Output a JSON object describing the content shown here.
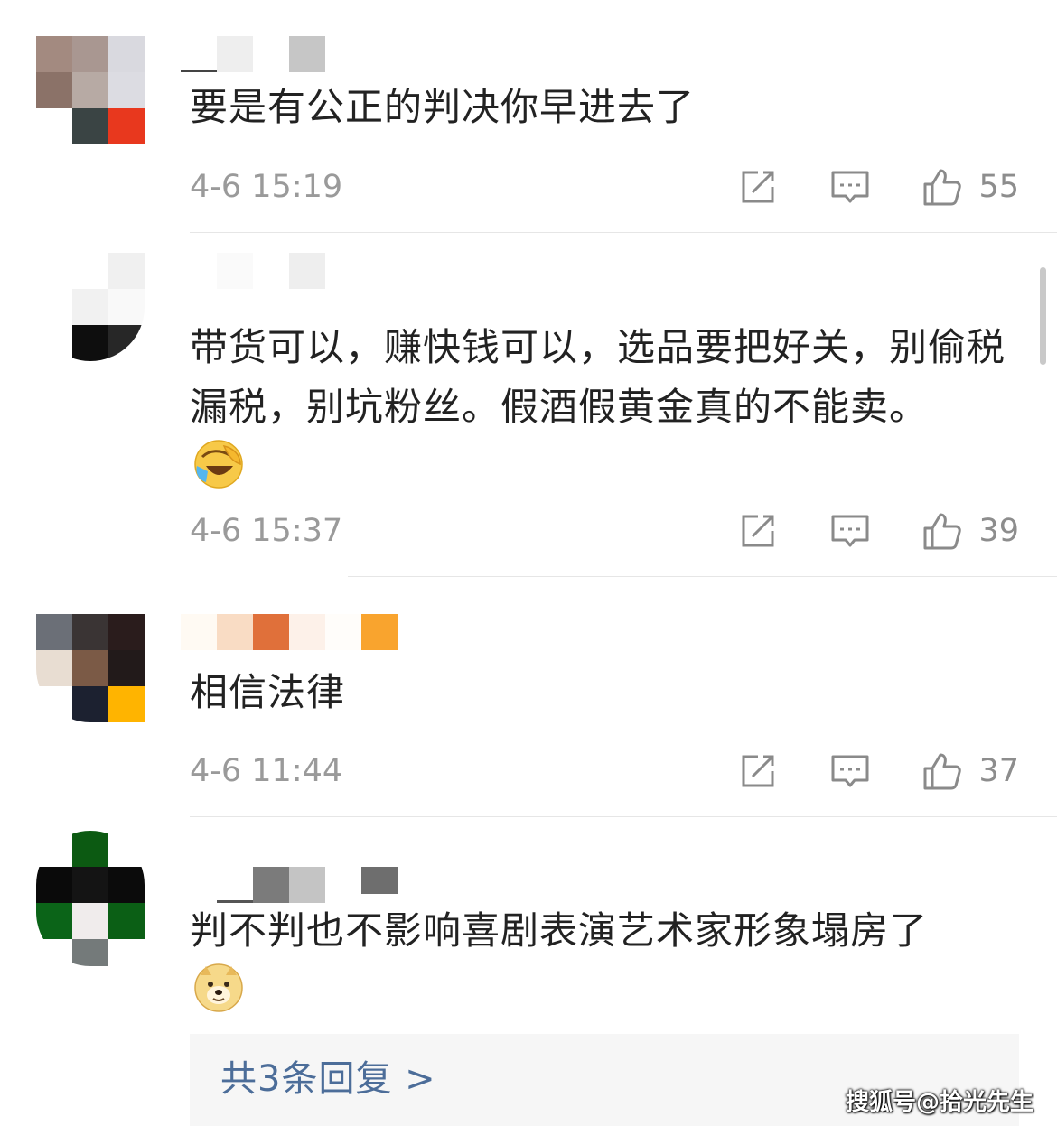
{
  "comments": [
    {
      "text": "要是有公正的判决你早进去了",
      "time": "4-6 15:19",
      "likes": "55"
    },
    {
      "text": "带货可以，赚快钱可以，选品要把好关，别偷税漏税，别坑粉丝。假酒假黄金真的不能卖。",
      "emoji": "laughing-crying-emoji",
      "time": "4-6 15:37",
      "likes": "39"
    },
    {
      "text": "相信法律",
      "time": "4-6 11:44",
      "likes": "37"
    },
    {
      "text": "判不判也不影响喜剧表演艺术家形象塌房了",
      "emoji": "doge-emoji"
    }
  ],
  "replies_link": "共3条回复 >",
  "watermark": "搜狐号@拾光先生",
  "icons": [
    "share-icon",
    "reply-icon",
    "like-icon"
  ],
  "colors": {
    "link": "#4c6d99",
    "meta": "#9a9a9a",
    "text": "#222222",
    "replies_bg": "#f6f6f6"
  }
}
